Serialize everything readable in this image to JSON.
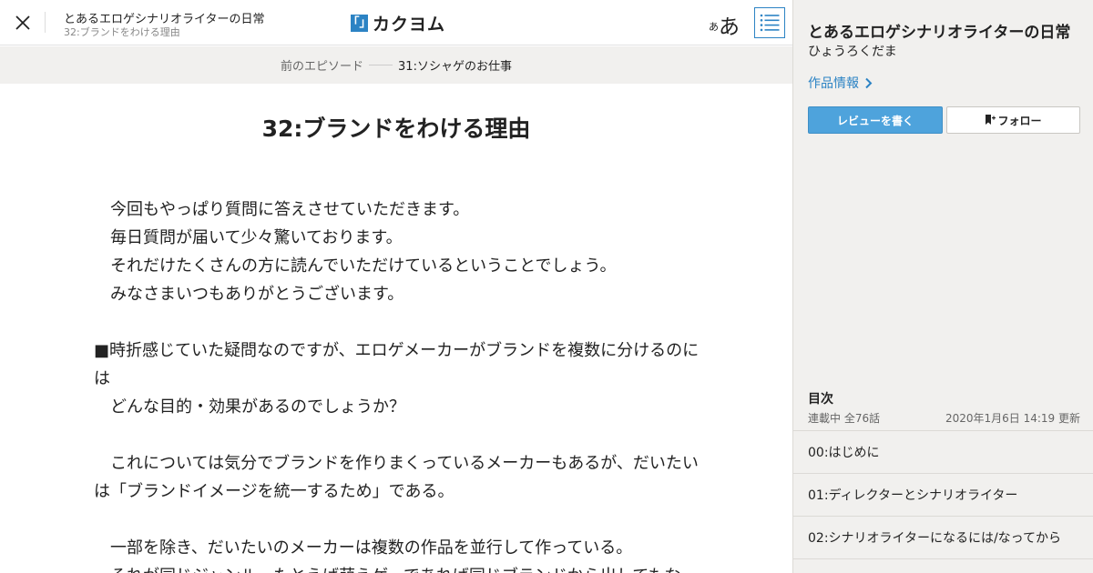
{
  "header": {
    "work_title": "とあるエロゲシナリオライターの日常",
    "episode_sub": "32:ブランドをわける理由",
    "logo_mark": "「」",
    "logo_text": "カクヨム",
    "font_small": "あ",
    "font_big": "あ"
  },
  "prev_bar": {
    "label": "前のエピソード",
    "title": "31:ソシャゲのお仕事"
  },
  "episode": {
    "title": "32:ブランドをわける理由",
    "paragraphs": [
      "　今回もやっぱり質問に答えさせていただきます。",
      "　毎日質問が届いて少々驚いております。",
      "　それだけたくさんの方に読んでいただけているということでしょう。",
      "　みなさまいつもありがとうございます。",
      "",
      "■時折感じていた疑問なのですが、エロゲメーカーがブランドを複数に分けるのには",
      "　どんな目的・効果があるのでしょうか？",
      "",
      "　これについては気分でブランドを作りまくっているメーカーもあるが、だいたいは「ブランドイメージを統一するため」である。",
      "",
      "　一部を除き、だいたいのメーカーは複数の作品を並行して作っている。",
      "　それが同じジャンル、たとえば萌えゲーであれば同じブランドから出してもな"
    ]
  },
  "sidebar": {
    "title": "とあるエロゲシナリオライターの日常",
    "author": "ひょうろくだま",
    "info_link": "作品情報",
    "review_button": "レビューを書く",
    "follow_button": "フォロー",
    "toc_heading": "目次",
    "toc_status": "連載中 全76話",
    "toc_updated": "2020年1月6日 14:19 更新",
    "toc_items": [
      "00:はじめに",
      "01:ディレクターとシナリオライター",
      "02:シナリオライターになるには/なってから"
    ]
  },
  "colors": {
    "accent": "#2c83c4",
    "review_button": "#4ea3dc",
    "sidebar_bg": "#f1f0ee"
  }
}
